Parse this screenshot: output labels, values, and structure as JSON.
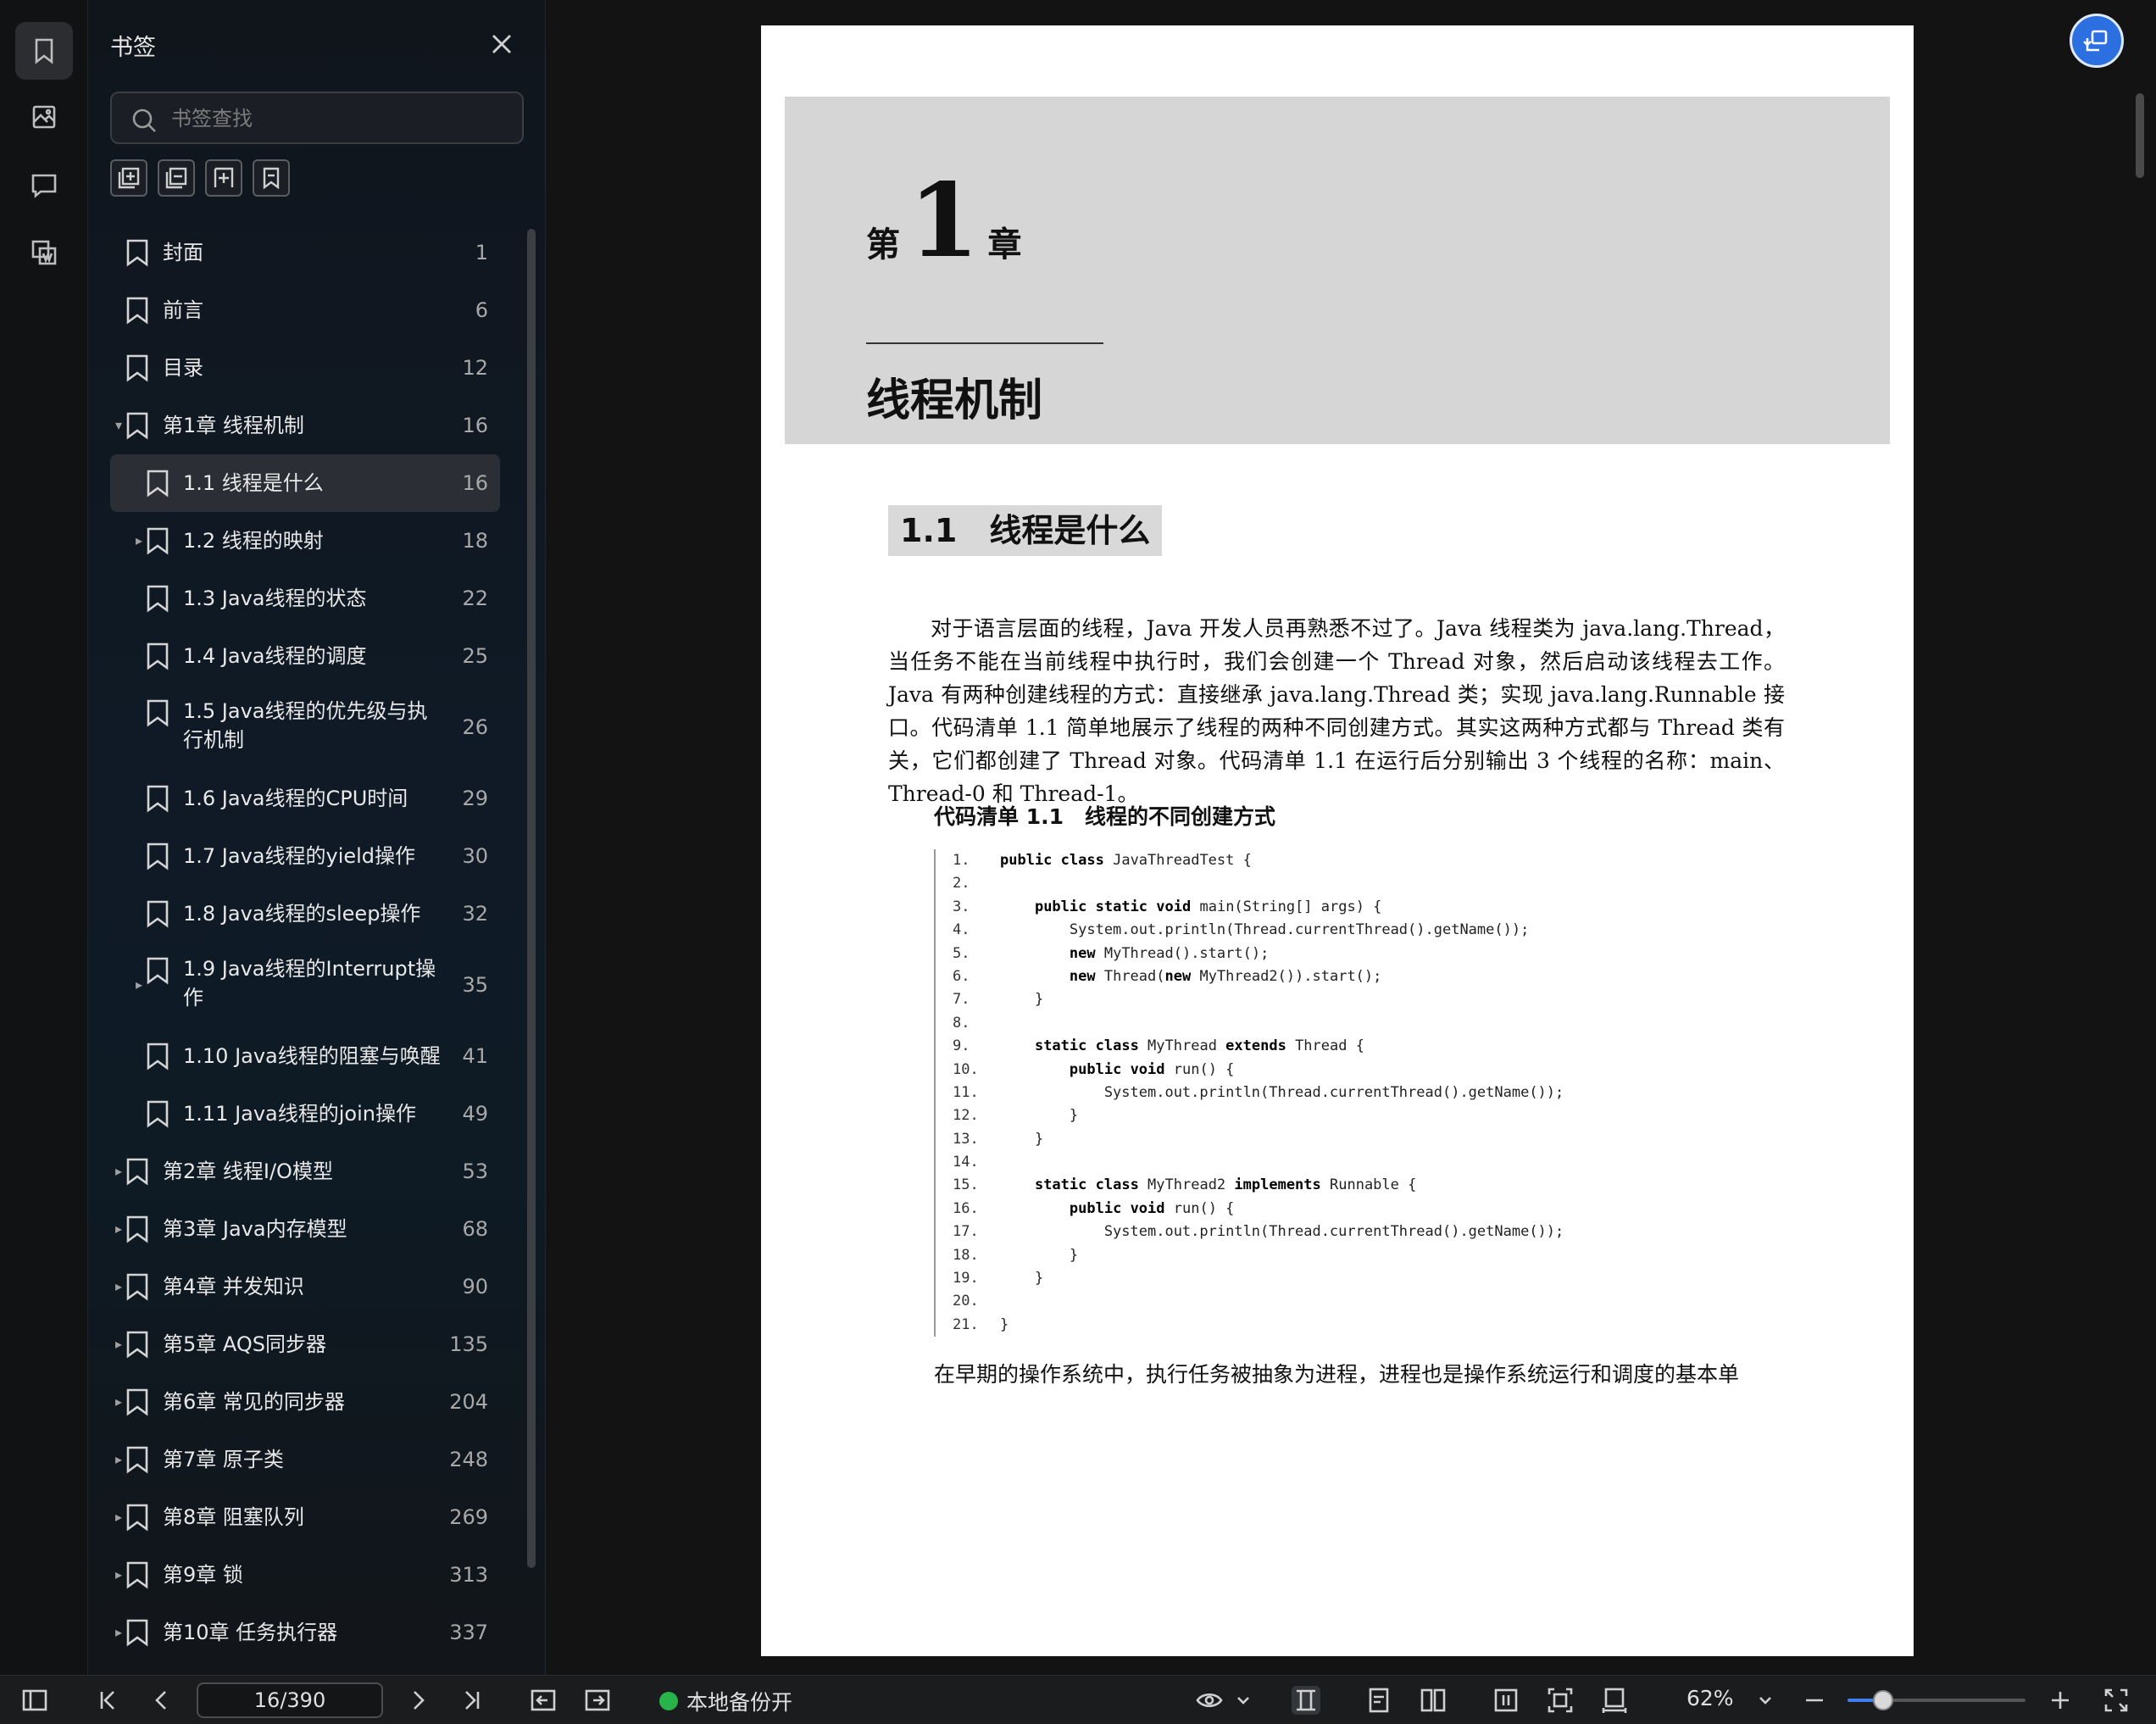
{
  "panel": {
    "title": "书签",
    "search_placeholder": "书签查找",
    "items": [
      {
        "label": "封面",
        "page": "1",
        "level": 0,
        "caret": "none"
      },
      {
        "label": "前言",
        "page": "6",
        "level": 0,
        "caret": "none"
      },
      {
        "label": "目录",
        "page": "12",
        "level": 0,
        "caret": "none"
      },
      {
        "label": "第1章 线程机制",
        "page": "16",
        "level": 0,
        "caret": "open"
      },
      {
        "label": "1.1 线程是什么",
        "page": "16",
        "level": 1,
        "caret": "none",
        "selected": true
      },
      {
        "label": "1.2 线程的映射",
        "page": "18",
        "level": 1,
        "caret": "closed"
      },
      {
        "label": "1.3 Java线程的状态",
        "page": "22",
        "level": 1,
        "caret": "none"
      },
      {
        "label": "1.4 Java线程的调度",
        "page": "25",
        "level": 1,
        "caret": "none"
      },
      {
        "label": "1.5 Java线程的优先级与执行机制",
        "page": "26",
        "level": 1,
        "caret": "none",
        "tall": true
      },
      {
        "label": "1.6 Java线程的CPU时间",
        "page": "29",
        "level": 1,
        "caret": "none"
      },
      {
        "label": "1.7 Java线程的yield操作",
        "page": "30",
        "level": 1,
        "caret": "none"
      },
      {
        "label": "1.8 Java线程的sleep操作",
        "page": "32",
        "level": 1,
        "caret": "none"
      },
      {
        "label": "1.9 Java线程的Interrupt操作",
        "page": "35",
        "level": 1,
        "caret": "closed",
        "tall": true
      },
      {
        "label": "1.10 Java线程的阻塞与唤醒",
        "page": "41",
        "level": 1,
        "caret": "none"
      },
      {
        "label": "1.11 Java线程的join操作",
        "page": "49",
        "level": 1,
        "caret": "none"
      },
      {
        "label": "第2章 线程I/O模型",
        "page": "53",
        "level": 0,
        "caret": "closed"
      },
      {
        "label": "第3章 Java内存模型",
        "page": "68",
        "level": 0,
        "caret": "closed"
      },
      {
        "label": "第4章 并发知识",
        "page": "90",
        "level": 0,
        "caret": "closed"
      },
      {
        "label": "第5章 AQS同步器",
        "page": "135",
        "level": 0,
        "caret": "closed"
      },
      {
        "label": "第6章 常见的同步器",
        "page": "204",
        "level": 0,
        "caret": "closed"
      },
      {
        "label": "第7章 原子类",
        "page": "248",
        "level": 0,
        "caret": "closed"
      },
      {
        "label": "第8章 阻塞队列",
        "page": "269",
        "level": 0,
        "caret": "closed"
      },
      {
        "label": "第9章 锁",
        "page": "313",
        "level": 0,
        "caret": "closed"
      },
      {
        "label": "第10章 任务执行器",
        "page": "337",
        "level": 0,
        "caret": "closed"
      }
    ]
  },
  "document": {
    "chapter_prefix": "第",
    "chapter_number": "1",
    "chapter_suffix": "章",
    "chapter_title": "线程机制",
    "section_heading": "1.1　线程是什么",
    "paragraph": "对于语言层面的线程，Java 开发人员再熟悉不过了。Java 线程类为 java.lang.Thread，当任务不能在当前线程中执行时，我们会创建一个 Thread 对象，然后启动该线程去工作。Java 有两种创建线程的方式：直接继承 java.lang.Thread 类；实现 java.lang.Runnable 接口。代码清单 1.1 简单地展示了线程的两种不同创建方式。其实这两种方式都与 Thread 类有关，它们都创建了 Thread 对象。代码清单 1.1 在运行后分别输出 3 个线程的名称：main、Thread-0 和 Thread-1。",
    "code_caption": "代码清单 1.1　线程的不同创建方式",
    "code_lines": [
      "public class JavaThreadTest {",
      "",
      "    public static void main(String[] args) {",
      "        System.out.println(Thread.currentThread().getName());",
      "        new MyThread().start();",
      "        new Thread(new MyThread2()).start();",
      "    }",
      "",
      "    static class MyThread extends Thread {",
      "        public void run() {",
      "            System.out.println(Thread.currentThread().getName());",
      "        }",
      "    }",
      "",
      "    static class MyThread2 implements Runnable {",
      "        public void run() {",
      "            System.out.println(Thread.currentThread().getName());",
      "        }",
      "    }",
      "",
      "}"
    ],
    "paragraph2": "在早期的操作系统中，执行任务被抽象为进程，进程也是操作系统运行和调度的基本单"
  },
  "toolbar": {
    "page_indicator": "16/390",
    "backup_label": "本地备份开",
    "zoom": "62%",
    "zoom_level": 0.2
  },
  "colors": {
    "accent": "#3d7ef0",
    "backup_status": "#28b44b"
  }
}
